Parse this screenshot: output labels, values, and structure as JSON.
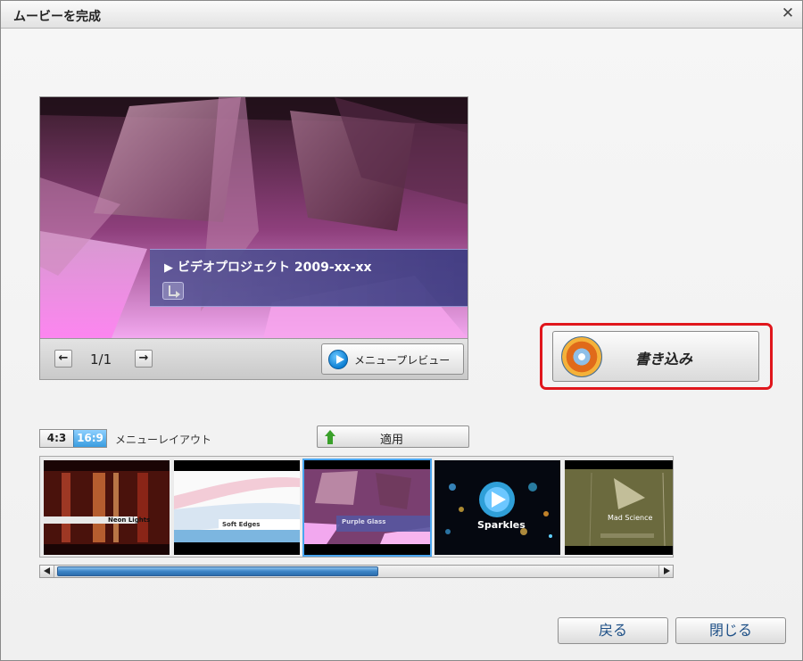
{
  "window": {
    "title": "ムービーを完成",
    "close_symbol": "✕"
  },
  "preview": {
    "menu_title": "ビデオプロジェクト 2009-xx-xx",
    "page_indicator": "1/1",
    "prev_symbol": "←",
    "next_symbol": "→",
    "menu_preview_label": "メニュープレビュー"
  },
  "burn": {
    "label": "書き込み"
  },
  "layout": {
    "aspect_options": [
      "4:3",
      "16:9"
    ],
    "selected_aspect": "16:9",
    "label": "メニューレイアウト",
    "apply_label": "適用"
  },
  "templates": [
    {
      "label": "Neon Lights",
      "selected": false
    },
    {
      "label": "Soft Edges",
      "selected": false
    },
    {
      "label": "Purple Glass",
      "selected": true
    },
    {
      "label": "Sparkles",
      "selected": false
    },
    {
      "label": "Mad Science",
      "selected": false
    }
  ],
  "scrollbar": {
    "position": 0.5
  },
  "footer": {
    "back_label": "戻る",
    "close_label": "閉じる"
  },
  "colors": {
    "highlight": "#e0161c",
    "selected": "#4aa6f0",
    "footer_text": "#1d4f86"
  }
}
